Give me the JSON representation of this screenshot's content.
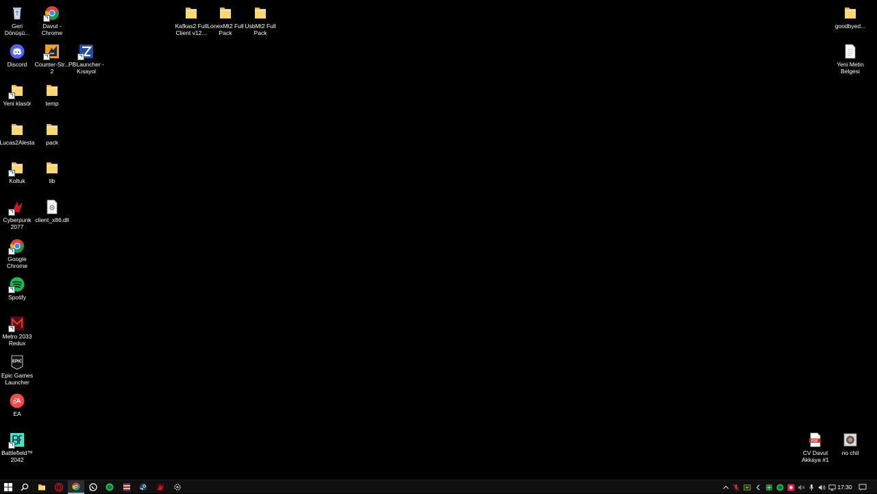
{
  "desktop": {
    "icons": [
      {
        "label": "Geri Dönüşü...",
        "icon": "recycle-bin-icon",
        "name": "desktop-icon-recycle-bin"
      },
      {
        "label": "Davut - Chrome",
        "icon": "chrome-icon",
        "name": "desktop-icon-davut-chrome"
      },
      {
        "label": "Discord",
        "icon": "discord-icon",
        "name": "desktop-icon-discord"
      },
      {
        "label": "Counter-Str... 2",
        "icon": "counter-strike-icon",
        "name": "desktop-icon-counter-strike-2"
      },
      {
        "label": "PBLauncher - Kısayol",
        "icon": "pblauncher-icon",
        "name": "desktop-icon-pblauncher"
      },
      {
        "label": "Yeni klasör",
        "icon": "folder-icon",
        "name": "desktop-icon-yeni-klasor"
      },
      {
        "label": "temp",
        "icon": "folder-icon",
        "name": "desktop-icon-temp"
      },
      {
        "label": "Lucas2Alesta",
        "icon": "folder-icon",
        "name": "desktop-icon-lucas2alesta"
      },
      {
        "label": "pack",
        "icon": "folder-icon",
        "name": "desktop-icon-pack"
      },
      {
        "label": "Koltuk",
        "icon": "folder-icon",
        "name": "desktop-icon-koltuk"
      },
      {
        "label": "lib",
        "icon": "folder-icon",
        "name": "desktop-icon-lib"
      },
      {
        "label": "Cyberpunk 2077",
        "icon": "cyberpunk-icon",
        "name": "desktop-icon-cyberpunk-2077"
      },
      {
        "label": "client_x86.dll",
        "icon": "dll-file-icon",
        "name": "desktop-icon-client-x86-dll"
      },
      {
        "label": "Google Chrome",
        "icon": "chrome-icon",
        "name": "desktop-icon-google-chrome"
      },
      {
        "label": "Spotify",
        "icon": "spotify-icon",
        "name": "desktop-icon-spotify"
      },
      {
        "label": "Metro 2033 Redux",
        "icon": "metro-icon",
        "name": "desktop-icon-metro-2033-redux"
      },
      {
        "label": "Epic Games Launcher",
        "icon": "epic-games-icon",
        "name": "desktop-icon-epic-games-launcher"
      },
      {
        "label": "EA",
        "icon": "ea-icon",
        "name": "desktop-icon-ea"
      },
      {
        "label": "Battlefield™ 2042",
        "icon": "battlefield-icon",
        "name": "desktop-icon-battlefield-2042"
      },
      {
        "label": "Kafkas2 Full Client v12...",
        "icon": "folder-icon",
        "name": "desktop-icon-kafkas2"
      },
      {
        "label": "LonexMt2 Full Pack",
        "icon": "folder-icon",
        "name": "desktop-icon-lonexmt2"
      },
      {
        "label": "UsbMt2 Full Pack",
        "icon": "folder-icon",
        "name": "desktop-icon-usbmt2"
      },
      {
        "label": "goodbyed...",
        "icon": "folder-icon",
        "name": "desktop-icon-goodbyed"
      },
      {
        "label": "Yeni Metin Belgesi",
        "icon": "text-file-icon",
        "name": "desktop-icon-yeni-metin-belgesi"
      },
      {
        "label": "CV Davut Akkaya #1",
        "icon": "pdf-file-icon",
        "name": "desktop-icon-cv-davut-akkaya"
      },
      {
        "label": "no chil",
        "icon": "image-file-icon",
        "name": "desktop-icon-no-chil"
      }
    ]
  },
  "taskbar": {
    "buttons": [
      {
        "icon": "windows-start-icon",
        "name": "start-button"
      },
      {
        "icon": "search-icon",
        "name": "taskbar-search-button"
      },
      {
        "icon": "file-explorer-icon",
        "name": "taskbar-file-explorer"
      },
      {
        "icon": "opera-icon",
        "name": "taskbar-opera"
      },
      {
        "icon": "chrome-icon",
        "name": "taskbar-chrome",
        "active": true
      },
      {
        "icon": "whatsapp-icon",
        "name": "taskbar-whatsapp"
      },
      {
        "icon": "spotify-icon",
        "name": "taskbar-spotify"
      },
      {
        "icon": "winrar-icon",
        "name": "taskbar-winrar"
      },
      {
        "icon": "steam-icon",
        "name": "taskbar-steam"
      },
      {
        "icon": "game-launcher-icon",
        "name": "taskbar-game-launcher"
      },
      {
        "icon": "gear-app-icon",
        "name": "taskbar-settings-app"
      }
    ],
    "tray": [
      {
        "icon": "chevron-up-icon",
        "name": "tray-show-hidden"
      },
      {
        "icon": "microphone-muted-icon",
        "name": "tray-mic-muted"
      },
      {
        "icon": "nvidia-icon",
        "name": "tray-nvidia"
      },
      {
        "icon": "arrow-icon",
        "name": "tray-arrow"
      },
      {
        "icon": "green-app-icon",
        "name": "tray-green-app"
      },
      {
        "icon": "spotify-icon",
        "name": "tray-spotify"
      },
      {
        "icon": "record-icon",
        "name": "tray-record"
      },
      {
        "icon": "speaker-muted-icon",
        "name": "tray-speaker-muted"
      },
      {
        "icon": "microphone-icon",
        "name": "tray-microphone"
      },
      {
        "icon": "volume-icon",
        "name": "tray-volume"
      },
      {
        "icon": "network-icon",
        "name": "tray-network"
      }
    ],
    "clock": "17:30",
    "notification_icon": "notification-icon"
  },
  "colors": {
    "desktop_background": "#000000",
    "taskbar_background": "#101010",
    "folder": "#f8d775",
    "active_underline": "#76b9ed"
  }
}
